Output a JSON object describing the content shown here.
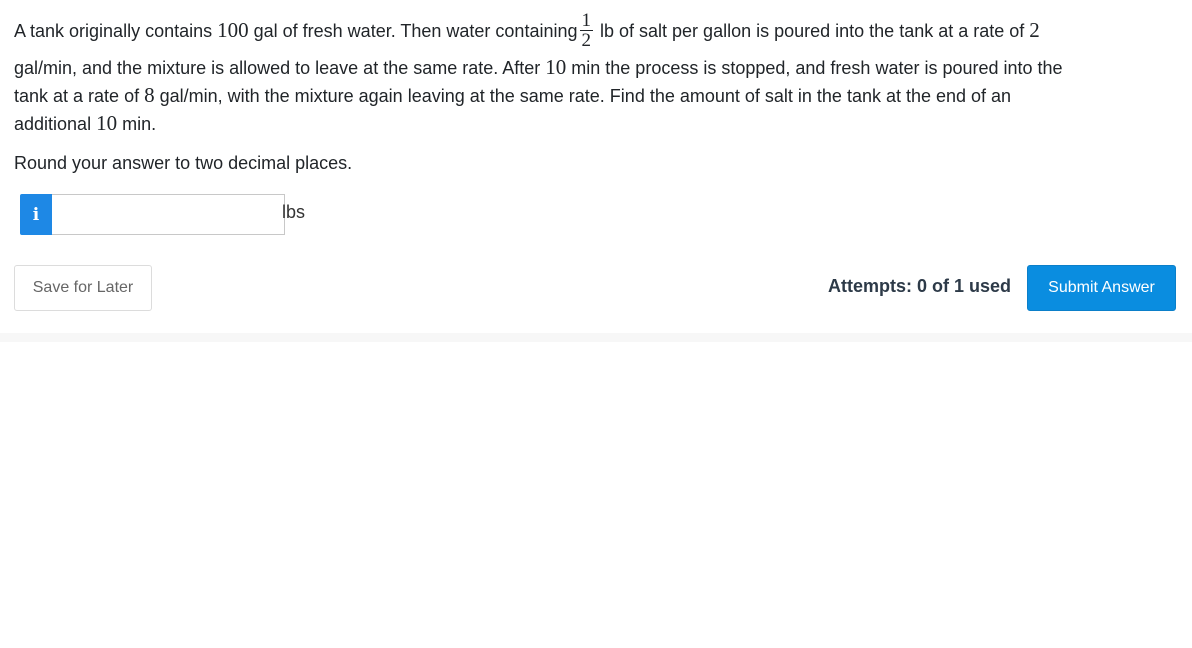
{
  "question": {
    "line1_pre": "A tank originally contains ",
    "initial_volume": "100",
    "line1_mid": " gal of fresh water. Then water containing",
    "fraction_numerator": "1",
    "fraction_denominator": "2",
    "line1_post": " lb of salt per gallon is poured into the tank at a rate of ",
    "inflow_rate": "2",
    "line2_pre": "gal/min, and the mixture is allowed to leave at the same rate. After ",
    "first_duration": "10",
    "line2_post": " min the process is stopped, and fresh water is poured into the",
    "line3_pre": "tank at a rate of ",
    "second_rate": "8",
    "line3_post": " gal/min, with the mixture again leaving at the same rate. Find the amount of salt in the tank at the end of an",
    "line4_pre": "additional ",
    "second_duration": "10",
    "line4_post": " min.",
    "round_note": "Round your answer to two decimal places."
  },
  "answer": {
    "info_badge": "i",
    "value": "",
    "placeholder": "",
    "unit": "lbs"
  },
  "footer": {
    "save_label": "Save for Later",
    "attempts_text": "Attempts: 0 of 1 used",
    "submit_label": "Submit Answer"
  },
  "colors": {
    "submit_bg": "#0a8de0",
    "info_badge_bg": "#1e88e5"
  }
}
